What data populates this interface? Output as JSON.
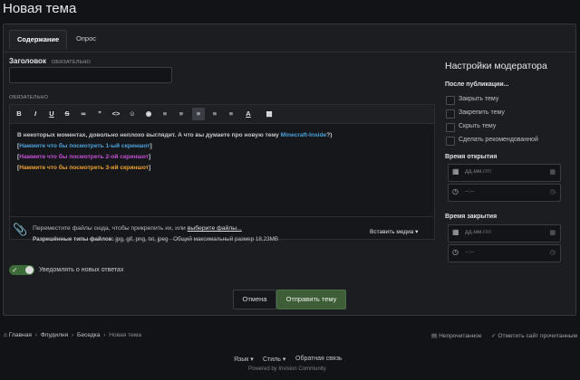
{
  "page_title": "Новая тема",
  "tabs": [
    {
      "label": "Содержание"
    },
    {
      "label": "Опрос"
    }
  ],
  "title_field": {
    "label": "Заголовок",
    "required": "ОБЯЗАТЕЛЬНО",
    "value": ""
  },
  "editor": {
    "required": "ОБЯЗАТЕЛЬНО",
    "toolbar_icons": [
      "bold-icon",
      "italic-icon",
      "underline-icon",
      "strikethrough-icon",
      "link-icon",
      "quote-icon",
      "code-icon",
      "emoji-icon",
      "spoiler-icon",
      "bullet-list-icon",
      "numbered-list-icon",
      "align-left-icon",
      "align-center-icon",
      "align-right-icon",
      "text-color-icon",
      "preview-icon"
    ],
    "line1_text": "В некоторых моментах, довольно неплохо выглядит. А что вы думаете про новую тему ",
    "line1_link": "Minecraft-Inside",
    "line1_end": "?)",
    "spoilers": [
      {
        "text": "Нажмите что бы посмотреть 1-ый скриншот",
        "color": "#4aa3df"
      },
      {
        "text": "Нажмите что бы посмотреть 2-ой скриншот",
        "color": "#c74fd6"
      },
      {
        "text": "Нажмите что бы посмотреть 3-ий скриншот",
        "color": "#f0a030"
      }
    ],
    "bracket_open": "[",
    "bracket_close": "]"
  },
  "attachments": {
    "drop_text": "Переместите файлы сюда, чтобы прикрепить их, или ",
    "choose_link": "выберите файлы...",
    "types_label": "Разрешённые типы файлов:",
    "types_value": " jpg, gif, png, txt, jpeg · Общий максимальный размер 18,23MB",
    "insert_media": "Вставить медиа ▾"
  },
  "notify": {
    "label": "Уведомлять о новых ответах",
    "on": true
  },
  "actions": {
    "cancel": "Отмена",
    "submit": "Отправить тему"
  },
  "moderator": {
    "heading": "Настройки модератора",
    "after_post": "После публикации...",
    "options": [
      "Закрыть тему",
      "Закрепить тему",
      "Скрыть тему",
      "Сделать рекомендованной"
    ],
    "open_time": "Время открытия",
    "close_time": "Время закрытия",
    "date_placeholder": "дд.мм.гггг",
    "time_placeholder": "--:--"
  },
  "breadcrumb": {
    "home": "Главная",
    "items": [
      "Флудилня",
      "Беседка",
      "Новая тема"
    ]
  },
  "right_links": {
    "unread": "Непрочитанное",
    "mark_read": "Отметить сайт прочитанным"
  },
  "footer": {
    "language": "Язык ▾",
    "style": "Стиль ▾",
    "feedback": "Обратная связь",
    "powered": "Powered by Invision Community"
  },
  "colors": {
    "accent_green": "#3e6b3a",
    "link_blue": "#4aa3df",
    "background": "#121316"
  }
}
